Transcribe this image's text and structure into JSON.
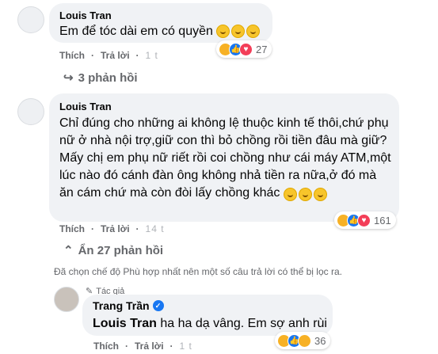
{
  "comments": [
    {
      "author": "Louis Tran",
      "text": "Em để tóc dài em có quyền",
      "actions": {
        "like": "Thích",
        "reply": "Trả lời",
        "time": "1 t"
      },
      "reactions": {
        "types": [
          "haha",
          "like",
          "love"
        ],
        "count": "27"
      },
      "replies_toggle": "3 phản hồi"
    },
    {
      "author": "Louis Tran",
      "text": "Chỉ đúng cho những ai không lệ thuộc kinh tế thôi,chứ phụ nữ ở nhà nội trợ,giữ con thì bỏ chồng rồi tiền đâu mà giữ? Mấy chị em phụ nữ riết rồi coi chồng như cái máy ATM,một lúc nào đó cánh đàn ông không nhả tiền ra nữa,ở đó mà ăn cám chứ mà còn đòi lấy chồng khác",
      "actions": {
        "like": "Thích",
        "reply": "Trả lời",
        "time": "14 t"
      },
      "reactions": {
        "types": [
          "haha",
          "like",
          "love"
        ],
        "count": "161"
      },
      "replies_toggle": "Ẩn 27 phản hồi"
    }
  ],
  "filter_notice": "Đã chọn chế độ Phù hợp nhất nên một số câu trả lời có thể bị lọc ra.",
  "reply": {
    "author_tag": "Tác giả",
    "author": "Trang Trần",
    "mention": "Louis Tran",
    "text": "ha ha dạ vâng. Em sợ anh rùi",
    "actions": {
      "like": "Thích",
      "reply": "Trả lời",
      "time": "1 t"
    },
    "reactions": {
      "types": [
        "haha",
        "like",
        "wow"
      ],
      "count": "36"
    }
  },
  "icons": {
    "reply_arrow": "↪",
    "chevron_up": "⌃",
    "pencil": "✎"
  }
}
